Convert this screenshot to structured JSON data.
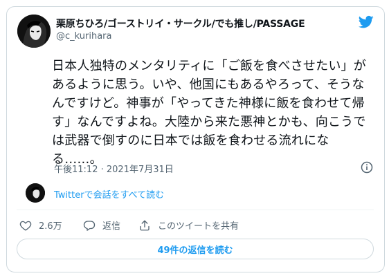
{
  "author": {
    "display_name": "栗原ちひろ/ゴーストリイ・サークル/でも推し/PASSAGE",
    "handle": "@c_kurihara"
  },
  "tweet": {
    "text": "日本人独特のメンタリティに「ご飯を食べさせたい」があるように思う。いや、他国にもあるやろって、そうなんですけど。神事が「やってきた神様に飯を食わせて帰す」なんですよね。大陸から来た悪神とかも、向こうでは武器で倒すのに日本では飯を食わせる流れになる……。",
    "timestamp": "午後11:12 · 2021年7月31日"
  },
  "conversation": {
    "link_label": "Twitterで会話をすべて読む"
  },
  "actions": {
    "like_count": "2.6万",
    "reply_label": "返信",
    "share_label": "このツイートを共有"
  },
  "replies_button": {
    "label": "49件の返信を読む"
  },
  "colors": {
    "accent": "#1d9bf0",
    "secondary_text": "#536471",
    "border": "#cfd9de"
  },
  "icons": [
    "twitter-bird-icon",
    "info-icon",
    "heart-icon",
    "reply-icon",
    "share-icon"
  ]
}
